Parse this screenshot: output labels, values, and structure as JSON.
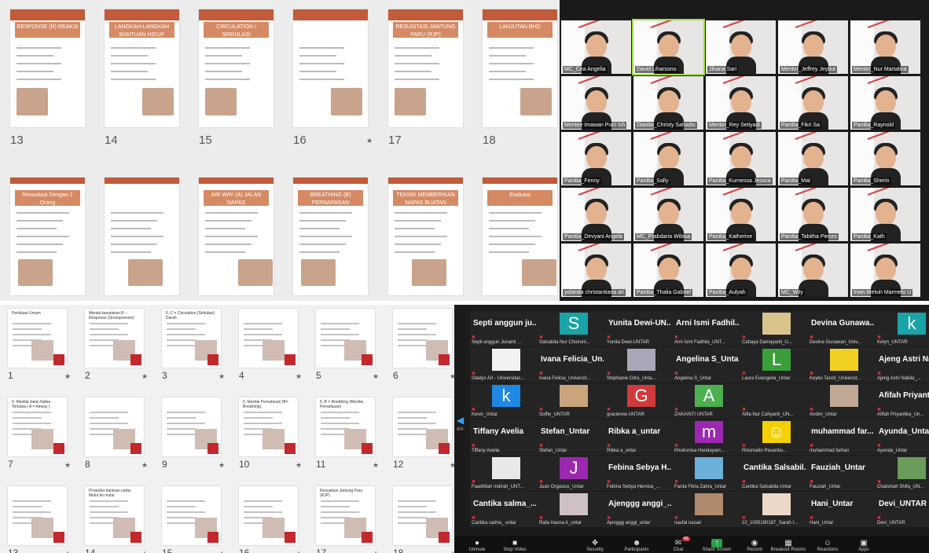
{
  "q1": {
    "row1": [
      {
        "num": "13",
        "title": "RESPONSE (R) REAKSI"
      },
      {
        "num": "14",
        "title": "LANGKAH-LANGKAH BANTUAN HIDUP DASAR"
      },
      {
        "num": "15",
        "title": "CIRCULATION / SIRKULASI"
      },
      {
        "num": "16",
        "title": ""
      },
      {
        "num": "17",
        "title": "RESUSITASI JANTUNG PARU (RJP)"
      },
      {
        "num": "18",
        "title": "LANJUTAN BHD"
      }
    ],
    "row2": [
      {
        "title": "Resusitasi Dengan 1 Orang"
      },
      {
        "title": ""
      },
      {
        "title": "AIR WAY (A) JALAN NAPAS"
      },
      {
        "title": "BREATHING (B) PERNAPASAN"
      },
      {
        "title": "TEKNIK MEMBERIKAN NAPAS BUATAN"
      },
      {
        "title": "Evaluasi"
      }
    ]
  },
  "q2": {
    "tiles": [
      "MC_Cea Angelia",
      "David Liharsono",
      "Jihana Sari",
      "Mentor_Jeffrey Jeybut",
      "Mentor_Nur Martalina",
      "Mentee Imawan Putri Ish",
      "Dianita_Christy Sahadis",
      "Mentor_Rey Setiyadi",
      "Panitia_Fikri Sa",
      "Panitia_Raynold",
      "Panitia_Fenny",
      "Panitia_Sally",
      "Panitia_Kurnessa Jessca",
      "Panitia_Mat",
      "Panitia_Sherin",
      "Panitia_Devyani Angela",
      "MC_Prabdaria Wibisa",
      "Panitia_Katherine",
      "Panitia_Tabitha Pieces",
      "Panitia_Kath",
      "yolanda christantiana ari",
      "Panitia_Thalia Gabriel",
      "Panitia_Aulyah",
      "MC_Wily",
      "Irwin Melvin Marmelo U"
    ]
  },
  "q3": {
    "nums": [
      "1",
      "2",
      "3",
      "4",
      "5",
      "6",
      "7",
      "8",
      "9",
      "10",
      "11",
      "12",
      "13",
      "14",
      "15",
      "16",
      "17",
      "18"
    ],
    "slide_titles": [
      "Penilaian Umum",
      "Mental kesadaran R – Response (Unresponsive)",
      "5. C = Circulation (Sirkulasi) Darah",
      "",
      "",
      "",
      "6. Menilai Jalan Nafas Terbuka ( A = Airway )",
      "",
      "",
      "5. Menilai Pernafasan (B= Breathing)",
      "5. B = Breathing (Menilai Pernafasan)",
      "",
      "",
      "Prosedur bantuan nafas Mulut ke mulut",
      "",
      "",
      "Resusitasi Jantung Paru (RJP)",
      ""
    ]
  },
  "q4": {
    "cells": [
      {
        "big": "Septi anggun ju...",
        "small": "Septi anggun Junanti ..."
      },
      {
        "av": "S",
        "avColor": "#1aa3a8",
        "small": "Salsabila Nur Choiruni..."
      },
      {
        "big": "Yunita Dewi-UN...",
        "small": "Yunita Dewi-UNTAR"
      },
      {
        "big": "Arni Ismi Fadhil...",
        "small": "Arni Ismi Fadhila_UNT..."
      },
      {
        "av": "",
        "avColor": "#d8c48c",
        "small": "Cahaya Damayanti_U..."
      },
      {
        "big": "Devina Gunawa...",
        "small": "Devina Gunawan_Univ..."
      },
      {
        "av": "k",
        "avColor": "#1aa3a8",
        "small": "Kelyn_UNTAR"
      },
      {
        "av": "",
        "avColor": "#f2f2f2",
        "small": "Gladys A/I - Universitas..."
      },
      {
        "big": "Ivana Felicia_Un...",
        "small": "Ivana Felicia_Universit..."
      },
      {
        "av": "",
        "avColor": "#a8a8b8",
        "small": "Stephanie Citra_Unta..."
      },
      {
        "big": "Angelina S_Untar",
        "small": "Angelina S_Untar"
      },
      {
        "av": "L",
        "avColor": "#3a9e3a",
        "small": "Laura Evangelia_Untar"
      },
      {
        "av": "",
        "avColor": "#f0d020",
        "small": "Keyko Tanzil_Universit..."
      },
      {
        "big": "Ajeng Astri Na...",
        "small": "Ajeng Astri Nabila_..."
      },
      {
        "av": "k",
        "avColor": "#1e88e5",
        "small": "Kevin_Untar"
      },
      {
        "av": "",
        "avColor": "#caa47a",
        "small": "Soffie_UNTAR"
      },
      {
        "av": "G",
        "avColor": "#d03a3a",
        "small": "gracierew UNTAR"
      },
      {
        "av": "A",
        "avColor": "#4caf50",
        "small": "ZAKIANTI UNTAR"
      },
      {
        "big": "",
        "small": "Alfia Nur Cahyanti_UN..."
      },
      {
        "av": "",
        "avColor": "#bfa894",
        "small": "Andini_Untar"
      },
      {
        "big": "Afifah Priyanti...",
        "small": "Afifah Priyantika_Un..."
      },
      {
        "big": "Tiffany Avelia",
        "small": "Tiffany Avelia"
      },
      {
        "big": "Stefan_Untar",
        "small": "Stefan_Untar"
      },
      {
        "big": "Ribka a_untar",
        "small": "Ribka a_untar"
      },
      {
        "av": "m",
        "avColor": "#9c27b0",
        "small": "Khoirunisa Handayani..."
      },
      {
        "av": "☺",
        "avColor": "#f5d000",
        "small": "Rinsmaito Pesanbu..."
      },
      {
        "big": "muhammad far...",
        "small": "muhammad farhan"
      },
      {
        "big": "Ayunda_Untar",
        "small": "Ayunda_Untar"
      },
      {
        "av": "",
        "avColor": "#e8e8e8",
        "small": "Faadhilah Indirah_UNT..."
      },
      {
        "av": "J",
        "avColor": "#9c27b0",
        "small": "Juan Orgasius_Untar"
      },
      {
        "big": "Febina Sebya H...",
        "small": "Febina Sebya Hernisa_..."
      },
      {
        "av": "",
        "avColor": "#6ab0d8",
        "small": "Farda Fitria Zahra_Untar"
      },
      {
        "big": "Cantika Salsabil...",
        "small": "Cantika Salsabila-Untar"
      },
      {
        "big": "Fauziah_Untar",
        "small": "Fauziah_Untar"
      },
      {
        "av": "",
        "avColor": "#6a9c5c",
        "small": "Chalishah Shifa_UN..."
      },
      {
        "big": "Cantika salma_...",
        "small": "Cantika salma_ untar"
      },
      {
        "av": "",
        "avColor": "#d0c0c8",
        "small": "Rafa Hasna A_untar"
      },
      {
        "big": "Ajenggg anggi_...",
        "small": "Ajenggg anggi_untar"
      },
      {
        "av": "",
        "avColor": "#b08a6c",
        "small": "naufal nasari"
      },
      {
        "av": "",
        "avColor": "#ecd8c8",
        "small": "10_1005180187_Sarah I..."
      },
      {
        "big": "Hani_Untar",
        "small": "Hani_Untar"
      },
      {
        "big": "Devi_UNTAR",
        "small": "Devi_UNTAR"
      }
    ],
    "toolbar": [
      {
        "icon": "●",
        "label": "Unmute"
      },
      {
        "icon": "■",
        "label": "Stop Video"
      },
      {
        "icon": "❖",
        "label": "Security"
      },
      {
        "icon": "☻",
        "label": "Participants"
      },
      {
        "icon": "✉",
        "label": "Chat",
        "badge": "46"
      },
      {
        "icon": "↑",
        "label": "Share Screen"
      },
      {
        "icon": "◉",
        "label": "Record"
      },
      {
        "icon": "▦",
        "label": "Breakout Rooms"
      },
      {
        "icon": "☺",
        "label": "Reactions"
      },
      {
        "icon": "▣",
        "label": "Apps"
      }
    ],
    "pager": "4/4"
  }
}
